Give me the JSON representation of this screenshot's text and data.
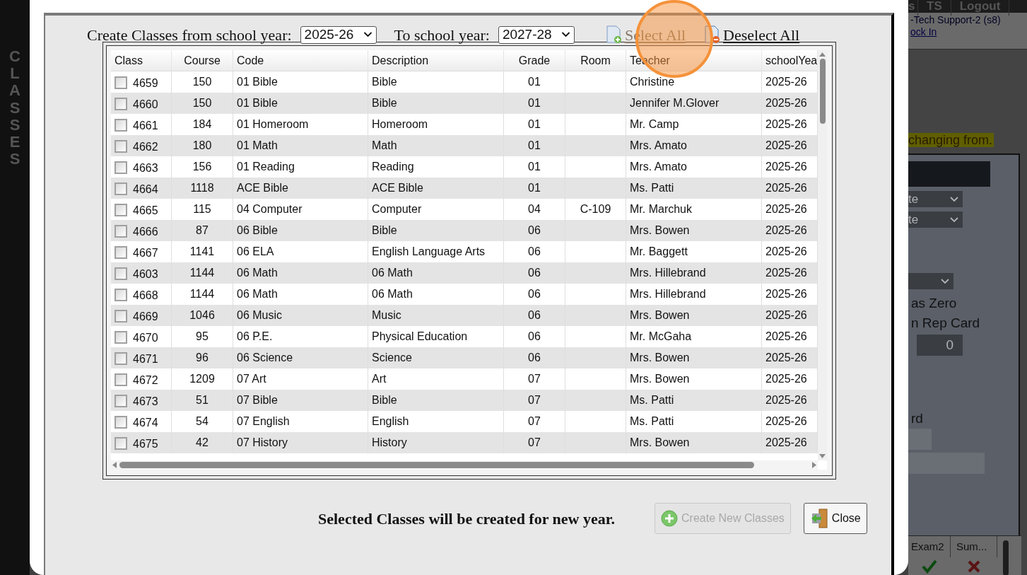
{
  "sidebar": {
    "label": "CLASSES"
  },
  "top_nav": [
    "s",
    "TS",
    "Logout"
  ],
  "user": {
    "name": "-Tech Support-2 (s8)",
    "link": "ock In"
  },
  "background_page": {
    "notice": "changing from.",
    "select_1": "te",
    "select_2": "te",
    "option_1": "as Zero",
    "option_2": "n Rep Card",
    "number_value": "0",
    "label": "rd",
    "grid_columns": [
      "Exam2",
      "Sum..."
    ],
    "grid_marks": [
      {
        "kind": "check"
      },
      {
        "kind": "cross"
      }
    ]
  },
  "dialog": {
    "from_label": "Create Classes from school year:",
    "from_year": "2025-26",
    "to_label": "To school year:",
    "to_year": "2027-28",
    "select_all": {
      "label": "Select All",
      "highlighted": true
    },
    "deselect_all": {
      "label": "Deselect All"
    },
    "columns": [
      "Class",
      "Course",
      "Code",
      "Description",
      "Grade",
      "Room",
      "Teacher",
      "schoolYea"
    ],
    "rows": [
      {
        "class": "4659",
        "course": "150",
        "code": "01 Bible",
        "description": "Bible",
        "grade": "01",
        "teacher": "Christine",
        "school_year": "2025-26",
        "checked": false
      },
      {
        "class": "4660",
        "course": "150",
        "code": "01 Bible",
        "description": "Bible",
        "grade": "01",
        "teacher": "Jennifer M.Glover",
        "school_year": "2025-26",
        "checked": false
      },
      {
        "class": "4661",
        "course": "184",
        "code": "01 Homeroom",
        "description": "Homeroom",
        "grade": "01",
        "teacher": "Mr. Camp",
        "school_year": "2025-26",
        "checked": false
      },
      {
        "class": "4662",
        "course": "180",
        "code": "01 Math",
        "description": "Math",
        "grade": "01",
        "teacher": "Mrs. Amato",
        "school_year": "2025-26",
        "checked": false
      },
      {
        "class": "4663",
        "course": "156",
        "code": "01 Reading",
        "description": "Reading",
        "grade": "01",
        "teacher": "Mrs. Amato",
        "school_year": "2025-26",
        "checked": false
      },
      {
        "class": "4664",
        "course": "1118",
        "code": "ACE Bible",
        "description": "ACE Bible",
        "grade": "01",
        "teacher": "Ms. Patti",
        "school_year": "2025-26",
        "checked": false
      },
      {
        "class": "4665",
        "course": "115",
        "code": "04 Computer",
        "description": "Computer",
        "grade": "04",
        "room": "C-109",
        "teacher": "Mr. Marchuk",
        "school_year": "2025-26",
        "checked": false
      },
      {
        "class": "4666",
        "course": "87",
        "code": "06 Bible",
        "description": "Bible",
        "grade": "06",
        "teacher": "Mrs. Bowen",
        "school_year": "2025-26",
        "checked": false
      },
      {
        "class": "4667",
        "course": "1141",
        "code": "06 ELA",
        "description": "English Language Arts",
        "grade": "06",
        "teacher": "Mr. Baggett",
        "school_year": "2025-26",
        "checked": false
      },
      {
        "class": "4603",
        "course": "1144",
        "code": "06 Math",
        "description": "06 Math",
        "grade": "06",
        "teacher": "Mrs. Hillebrand",
        "school_year": "2025-26",
        "checked": false
      },
      {
        "class": "4668",
        "course": "1144",
        "code": "06 Math",
        "description": "06 Math",
        "grade": "06",
        "teacher": "Mrs. Hillebrand",
        "school_year": "2025-26",
        "checked": false
      },
      {
        "class": "4669",
        "course": "1046",
        "code": "06 Music",
        "description": "Music",
        "grade": "06",
        "teacher": "Mrs. Bowen",
        "school_year": "2025-26",
        "checked": false
      },
      {
        "class": "4670",
        "course": "95",
        "code": "06 P.E.",
        "description": "Physical Education",
        "grade": "06",
        "teacher": "Mr. McGaha",
        "school_year": "2025-26",
        "checked": false
      },
      {
        "class": "4671",
        "course": "96",
        "code": "06 Science",
        "description": "Science",
        "grade": "06",
        "teacher": "Mrs. Bowen",
        "school_year": "2025-26",
        "checked": false
      },
      {
        "class": "4672",
        "course": "1209",
        "code": "07 Art",
        "description": "Art",
        "grade": "07",
        "teacher": "Mrs. Bowen",
        "school_year": "2025-26",
        "checked": false
      },
      {
        "class": "4673",
        "course": "51",
        "code": "07 Bible",
        "description": "Bible",
        "grade": "07",
        "teacher": "Ms. Patti",
        "school_year": "2025-26",
        "checked": false
      },
      {
        "class": "4674",
        "course": "54",
        "code": "07 English",
        "description": "English",
        "grade": "07",
        "teacher": "Ms. Patti",
        "school_year": "2025-26",
        "checked": false
      },
      {
        "class": "4675",
        "course": "42",
        "code": "07 History",
        "description": "History",
        "grade": "07",
        "teacher": "Mrs. Bowen",
        "school_year": "2025-26",
        "checked": false
      }
    ],
    "message": "Selected Classes will be created for new year.",
    "buttons": [
      {
        "label": "Create New Classes",
        "kind": "create",
        "disabled": true
      },
      {
        "label": "Close",
        "kind": "close",
        "disabled": false
      }
    ]
  }
}
